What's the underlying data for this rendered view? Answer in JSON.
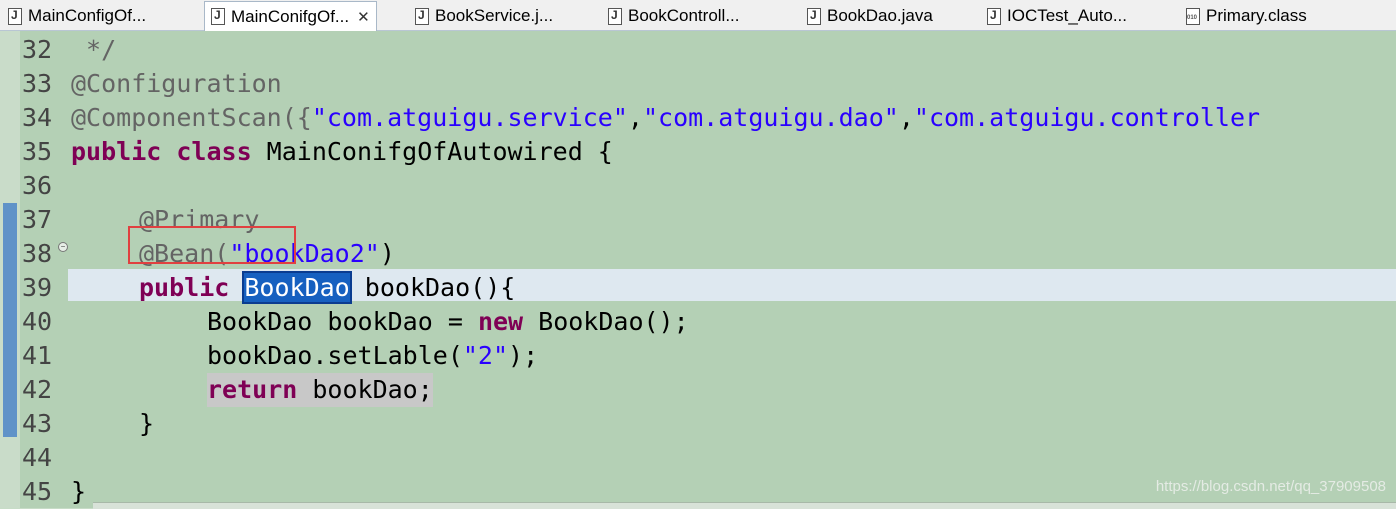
{
  "tabs": [
    {
      "label": "MainConfigOf...",
      "icon": "java-file-icon",
      "active": false
    },
    {
      "label": "MainConifgOf...",
      "icon": "java-file-icon",
      "active": true,
      "close": "✕"
    },
    {
      "label": "BookService.j...",
      "icon": "java-file-icon",
      "active": false
    },
    {
      "label": "BookControll...",
      "icon": "java-file-icon",
      "active": false
    },
    {
      "label": "BookDao.java",
      "icon": "java-file-icon",
      "active": false
    },
    {
      "label": "IOCTest_Auto...",
      "icon": "java-file-icon",
      "active": false
    },
    {
      "label": "Primary.class",
      "icon": "class-file-icon",
      "active": false
    }
  ],
  "editor": {
    "lines": [
      {
        "num": "32",
        "text": " */"
      },
      {
        "num": "33",
        "text": "@Configuration"
      },
      {
        "num": "34",
        "text": "@ComponentScan({\"com.atguigu.service\",\"com.atguigu.dao\",\"com.atguigu.controller"
      },
      {
        "num": "35",
        "text": "public class MainConifgOfAutowired {"
      },
      {
        "num": "36",
        "text": ""
      },
      {
        "num": "37",
        "text": "    @Primary"
      },
      {
        "num": "38",
        "text": "    @Bean(\"bookDao2\")"
      },
      {
        "num": "39",
        "text": "    public BookDao bookDao(){"
      },
      {
        "num": "40",
        "text": "        BookDao bookDao = new BookDao();"
      },
      {
        "num": "41",
        "text": "        bookDao.setLable(\"2\");"
      },
      {
        "num": "42",
        "text": "        return bookDao;"
      },
      {
        "num": "43",
        "text": "    }"
      },
      {
        "num": "44",
        "text": ""
      },
      {
        "num": "45",
        "text": "}"
      }
    ],
    "tokens": {
      "l32": " */",
      "l33": "@Configuration",
      "l34_a": "@ComponentScan({",
      "l34_s1": "\"com.atguigu.service\"",
      "l34_c1": ",",
      "l34_s2": "\"com.atguigu.dao\"",
      "l34_c2": ",",
      "l34_s3": "\"com.atguigu.controller",
      "l35_kw": "public class",
      "l35_rest": " MainConifgOfAutowired {",
      "l37": "@Primary",
      "l38_a": "@Bean(",
      "l38_s": "\"bookDao2\"",
      "l38_b": ")",
      "l39_kw": "public",
      "l39_sel": "BookDao",
      "l39_rest": " bookDao(){",
      "l40_a": "BookDao bookDao = ",
      "l40_kw": "new",
      "l40_b": " BookDao();",
      "l41_a": "bookDao.setLable(",
      "l41_s": "\"2\"",
      "l41_b": ");",
      "l42_kw": "return",
      "l42_rest": " bookDao;",
      "l43": "}",
      "l45": "}"
    },
    "colors": {
      "keyword": "#7f0055",
      "string": "#2a00ff",
      "annotation": "#646464",
      "selection": "#1660c0",
      "background": "#b4d0b5"
    }
  },
  "watermark": "https://blog.csdn.net/qq_37909508"
}
